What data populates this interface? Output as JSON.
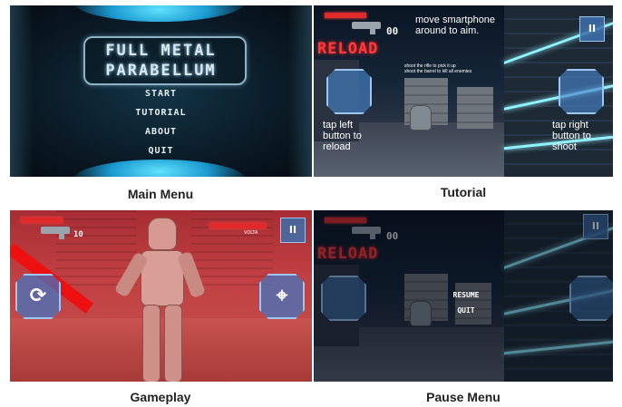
{
  "panels": {
    "main_menu": {
      "title_line1": "FULL METAL",
      "title_line2": "PARABELLUM",
      "menu_items": [
        "START",
        "TUTORIAL",
        "ABOUT",
        "QUIT"
      ],
      "caption": "Main Menu"
    },
    "tutorial": {
      "ammo": "00",
      "reload_label": "RELOAD",
      "pause_label": "II",
      "aim_hint_line1": "move smartphone",
      "aim_hint_line2": "around to aim.",
      "small_hint_line1": "shoot the rifle to pick it up",
      "small_hint_line2": "shoot the barrel to kill all enemies",
      "left_hint_line1": "tap left",
      "left_hint_line2": "button to",
      "left_hint_line3": "reload",
      "right_hint_line1": "tap right",
      "right_hint_line2": "button to",
      "right_hint_line3": "shoot",
      "caption": "Tutorial"
    },
    "gameplay": {
      "ammo": "10",
      "enemy_label": "VOLTA",
      "pause_label": "II",
      "caption": "Gameplay"
    },
    "pause_menu": {
      "ammo": "00",
      "reload_label": "RELOAD",
      "pause_label": "II",
      "resume_label": "RESUME",
      "quit_label": "QUIT",
      "caption": "Pause Menu"
    }
  },
  "colors": {
    "reload_red": "#ff3a3a",
    "hud_blue": "#4682c8",
    "neon_cyan": "#8ff2ff",
    "damage_red": "#c24043"
  },
  "icons": [
    "gun-icon",
    "reload-icon",
    "crosshair-icon",
    "pause-icon"
  ]
}
